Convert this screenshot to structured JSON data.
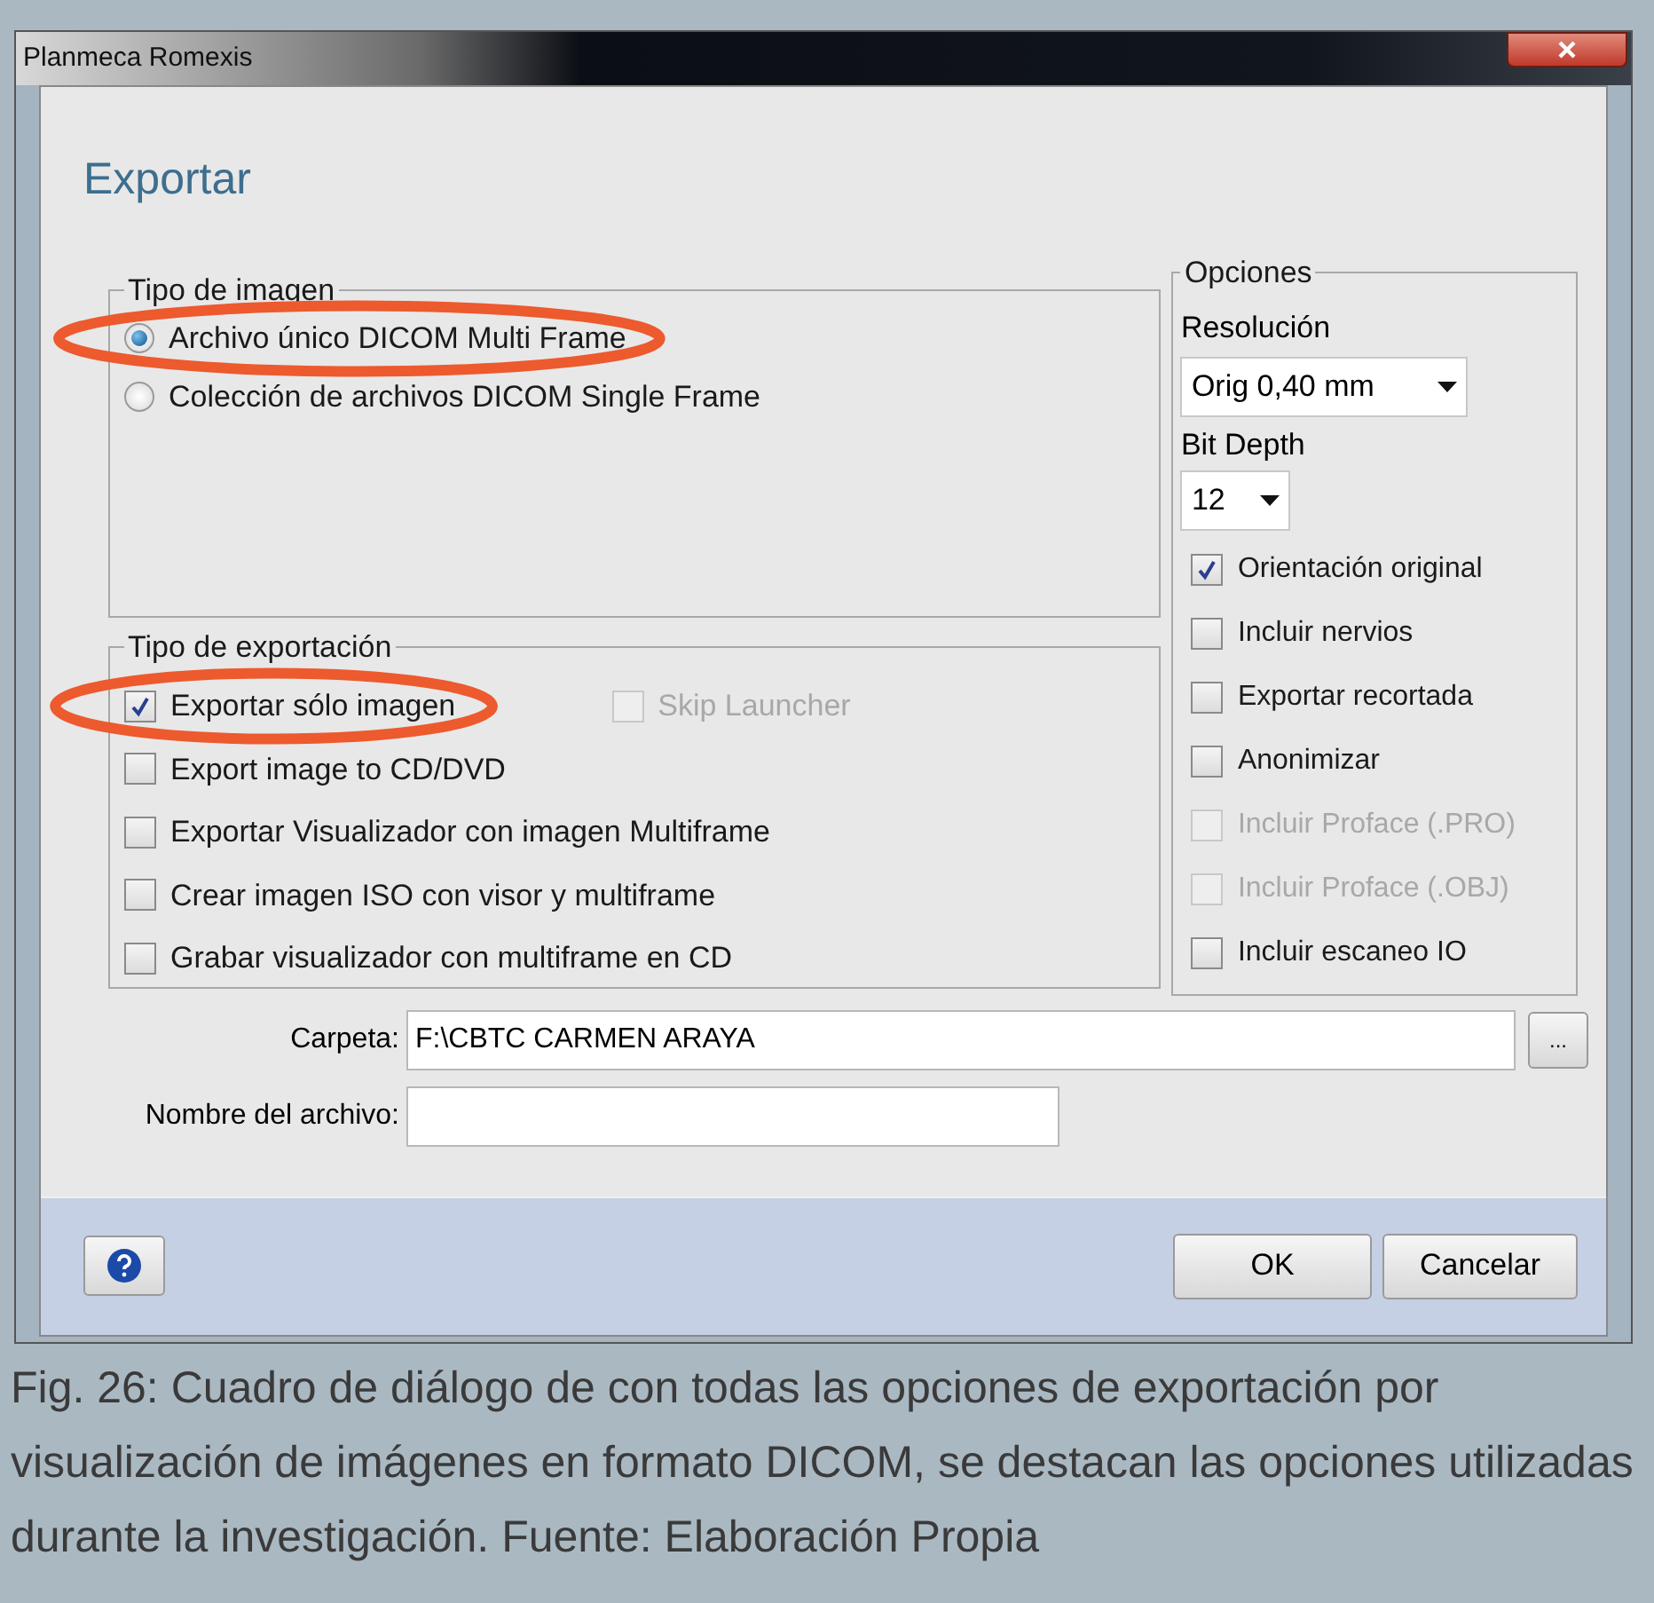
{
  "window": {
    "title": "Planmeca Romexis"
  },
  "dialog": {
    "heading": "Exportar"
  },
  "image_type": {
    "legend": "Tipo de imagen",
    "options": [
      {
        "label": "Archivo único DICOM Multi Frame",
        "selected": true,
        "highlighted": true
      },
      {
        "label": "Colección de archivos DICOM Single Frame",
        "selected": false,
        "highlighted": false
      }
    ]
  },
  "export_type": {
    "legend": "Tipo de exportación",
    "options": [
      {
        "label": "Exportar sólo imagen",
        "checked": true,
        "disabled": false,
        "highlighted": true
      },
      {
        "label": "Export image to CD/DVD",
        "checked": false,
        "disabled": false,
        "highlighted": false
      },
      {
        "label": "Exportar Visualizador con imagen Multiframe",
        "checked": false,
        "disabled": false,
        "highlighted": false
      },
      {
        "label": "Crear imagen ISO con visor y multiframe",
        "checked": false,
        "disabled": false,
        "highlighted": false
      },
      {
        "label": "Grabar visualizador con multiframe en CD",
        "checked": false,
        "disabled": false,
        "highlighted": false
      }
    ],
    "side_option": {
      "label": "Skip Launcher",
      "checked": false,
      "disabled": true
    }
  },
  "options": {
    "legend": "Opciones",
    "resolution": {
      "label": "Resolución",
      "value": "Orig 0,40 mm"
    },
    "bit_depth": {
      "label": "Bit Depth",
      "value": "12"
    },
    "checkboxes": [
      {
        "label": "Orientación original",
        "checked": true,
        "disabled": false
      },
      {
        "label": "Incluir nervios",
        "checked": false,
        "disabled": false
      },
      {
        "label": "Exportar recortada",
        "checked": false,
        "disabled": false
      },
      {
        "label": "Anonimizar",
        "checked": false,
        "disabled": false
      },
      {
        "label": "Incluir Proface (.PRO)",
        "checked": false,
        "disabled": true
      },
      {
        "label": "Incluir Proface (.OBJ)",
        "checked": false,
        "disabled": true
      },
      {
        "label": "Incluir escaneo IO",
        "checked": false,
        "disabled": false
      }
    ]
  },
  "folder": {
    "label": "Carpeta:",
    "value": "F:\\CBTC CARMEN ARAYA",
    "browse": "..."
  },
  "file_name": {
    "label": "Nombre del archivo:"
  },
  "buttons": [
    "OK",
    "Cancelar"
  ],
  "caption": "Fig. 26: Cuadro de diálogo de con todas las opciones de exportación por visualización de imágenes en formato DICOM, se destacan las opciones utilizadas durante la investigación. Fuente: Elaboración Propia"
}
